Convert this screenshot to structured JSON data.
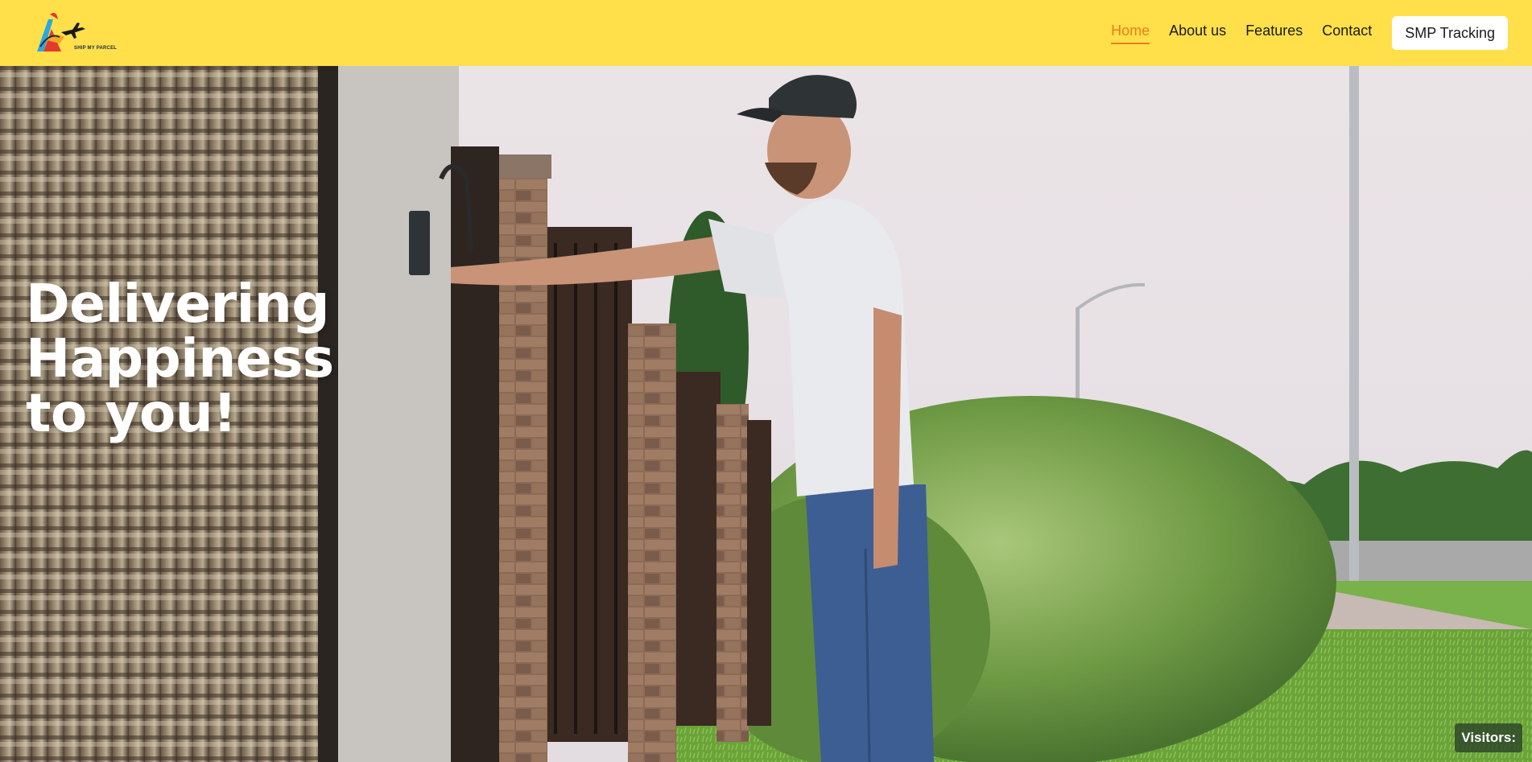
{
  "brand": {
    "logo_text": "SHIP MY PARCEL"
  },
  "nav": {
    "items": [
      {
        "label": "Home",
        "active": true
      },
      {
        "label": "About us",
        "active": false
      },
      {
        "label": "Features",
        "active": false
      },
      {
        "label": "Contact",
        "active": false
      }
    ],
    "tracking_button": "SMP Tracking"
  },
  "hero": {
    "headline": "Delivering Happiness\nto you!"
  },
  "footer_badge": {
    "visitors_label": "Visitors:"
  },
  "colors": {
    "topbar": "#ffe04a",
    "active_link": "#f07b1b"
  }
}
